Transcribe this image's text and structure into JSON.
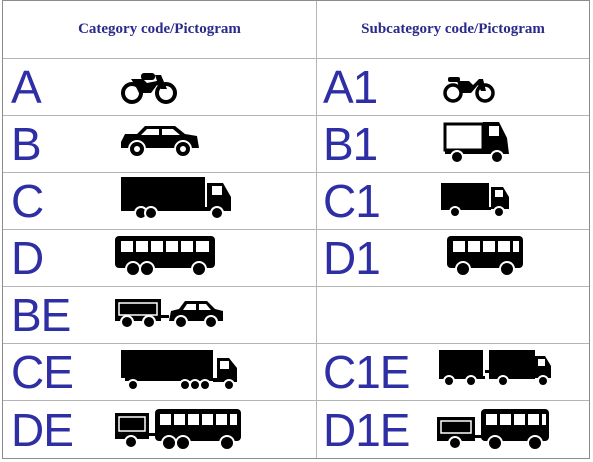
{
  "header": {
    "category": "Category code/Pictogram",
    "subcategory": "Subcategory code/Pictogram"
  },
  "rows": [
    {
      "category": {
        "code": "A",
        "icon": "motorcycle-icon"
      },
      "subcategory": {
        "code": "A1",
        "icon": "light-motorcycle-icon"
      }
    },
    {
      "category": {
        "code": "B",
        "icon": "car-icon"
      },
      "subcategory": {
        "code": "B1",
        "icon": "light-vehicle-icon"
      }
    },
    {
      "category": {
        "code": "C",
        "icon": "truck-icon"
      },
      "subcategory": {
        "code": "C1",
        "icon": "small-truck-icon"
      }
    },
    {
      "category": {
        "code": "D",
        "icon": "bus-icon"
      },
      "subcategory": {
        "code": "D1",
        "icon": "minibus-icon"
      }
    },
    {
      "category": {
        "code": "BE",
        "icon": "car-with-trailer-icon"
      },
      "subcategory": {
        "code": "",
        "icon": ""
      }
    },
    {
      "category": {
        "code": "CE",
        "icon": "articulated-truck-icon"
      },
      "subcategory": {
        "code": "C1E",
        "icon": "small-truck-with-trailer-icon"
      }
    },
    {
      "category": {
        "code": "DE",
        "icon": "bus-with-trailer-icon"
      },
      "subcategory": {
        "code": "D1E",
        "icon": "minibus-with-trailer-icon"
      }
    }
  ],
  "colors": {
    "code_text": "#2e2ea5",
    "header_text": "#2a2a8a",
    "pictogram": "#000000",
    "grid": "#b5b5b5"
  }
}
